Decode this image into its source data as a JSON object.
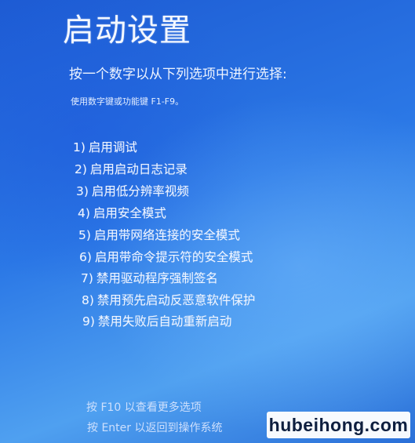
{
  "screen": {
    "title": "启动设置",
    "instruction": "按一个数字以从下列选项中进行选择:",
    "hint": "使用数字键或功能键 F1-F9。"
  },
  "options": [
    {
      "num": "1)",
      "label": "启用调试"
    },
    {
      "num": "2)",
      "label": "启用启动日志记录"
    },
    {
      "num": "3)",
      "label": "启用低分辨率视频"
    },
    {
      "num": "4)",
      "label": "启用安全模式"
    },
    {
      "num": "5)",
      "label": "启用带网络连接的安全模式"
    },
    {
      "num": "6)",
      "label": "启用带命令提示符的安全模式"
    },
    {
      "num": "7)",
      "label": "禁用驱动程序强制签名"
    },
    {
      "num": "8)",
      "label": "禁用预先启动反恶意软件保护"
    },
    {
      "num": "9)",
      "label": "禁用失败后自动重新启动"
    }
  ],
  "footer": {
    "more_options": "按 F10 以查看更多选项",
    "return_os": "按 Enter 以返回到操作系统"
  },
  "watermark": "hubeihong.com",
  "colors": {
    "background": "#2b78e6",
    "text": "#f0f5ff"
  }
}
